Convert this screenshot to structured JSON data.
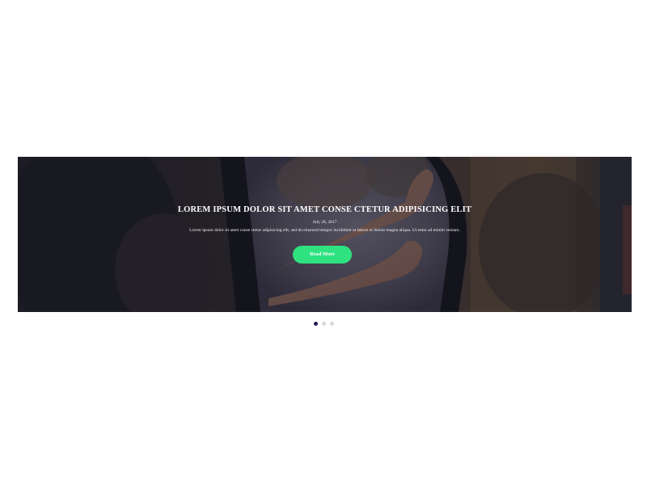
{
  "slider": {
    "active_index": 0,
    "slides_count": 3,
    "slide": {
      "title": "LOREM IPSUM DOLOR SIT AMET CONSE CTETUR ADIPISICING ELIT",
      "date": "July 28, 2017",
      "text": "Lorem ipsum dolor sit amet conse ctetur adipisicing elit, sed do eiusmod tempor incididunt ut labore et dolore magna aliqua. Ut enim ad minim veniam.",
      "button_label": "Read More",
      "image": "photo-feet-out-car-window"
    },
    "dots": [
      {
        "label": "slide 1",
        "active": true
      },
      {
        "label": "slide 2",
        "active": false
      },
      {
        "label": "slide 3",
        "active": false
      }
    ]
  },
  "colors": {
    "button": "#2ee27f",
    "dot_active": "#1d1a56",
    "dot_inactive": "#d8d8de",
    "overlay": "#0a0a19"
  }
}
